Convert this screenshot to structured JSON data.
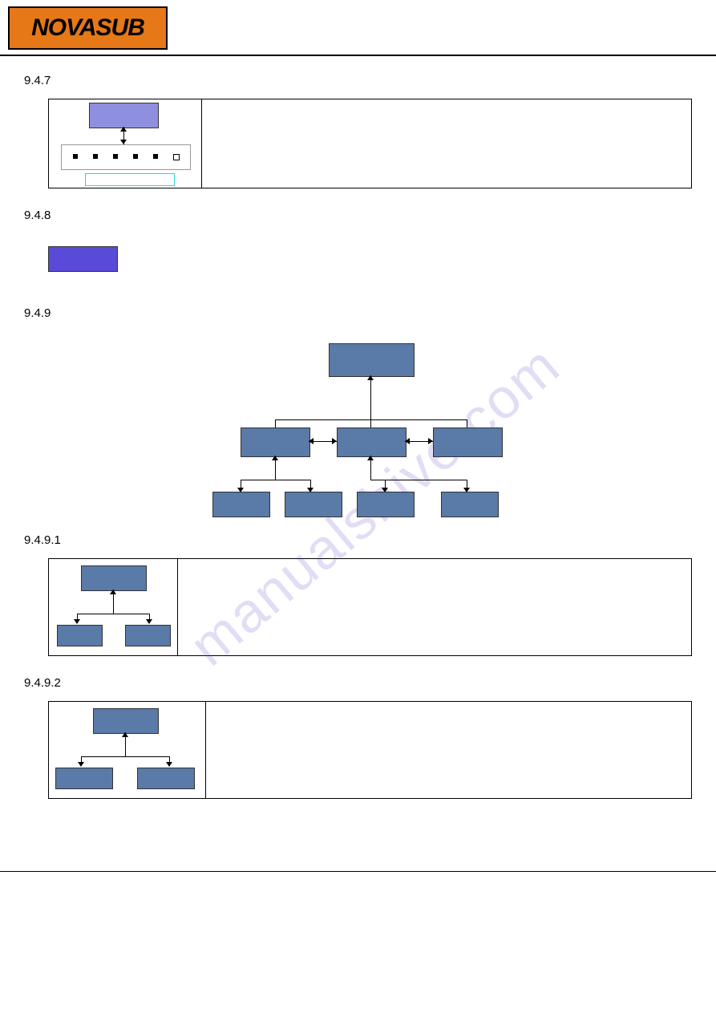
{
  "logo_text": "NOVASUB",
  "sections": {
    "s1": "9.4.7",
    "s2": "9.4.8",
    "s3": "9.4.9",
    "s4": "9.4.9.1",
    "s5": "9.4.9.2"
  },
  "watermark": "manualshive.com"
}
